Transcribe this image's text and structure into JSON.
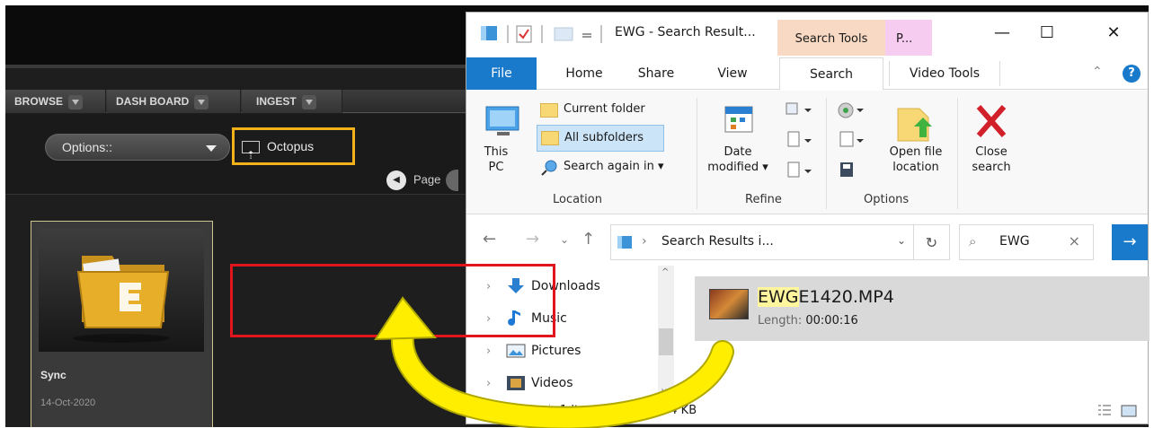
{
  "background_app": {
    "tabs": [
      {
        "label": "BROWSE"
      },
      {
        "label": "DASH BOARD"
      },
      {
        "label": "INGEST"
      }
    ],
    "options_select": {
      "value": "Options::"
    },
    "octopus_button": {
      "label": "Octopus"
    },
    "page_nav": {
      "label": "Page"
    },
    "card": {
      "name": "Sync",
      "date": "14-Oct-2020"
    }
  },
  "explorer": {
    "title": "EWG - Search Result...",
    "context_tabs": {
      "search_tools": "Search Tools",
      "p": "P..."
    },
    "window_controls": {
      "minimize": "—",
      "maximize": "☐",
      "close": "✕"
    },
    "ribbon_tabs": [
      "File",
      "Home",
      "Share",
      "View",
      "Search",
      "Video Tools"
    ],
    "ribbon": {
      "this_pc": [
        "This",
        "PC"
      ],
      "current_folder": "Current folder",
      "all_subfolders": "All subfolders",
      "search_again": "Search again in ▾",
      "location_label": "Location",
      "date_modified": [
        "Date",
        "modified ▾"
      ],
      "refine_label": "Refine",
      "open_file_location": [
        "Open file",
        "location"
      ],
      "options_label": "Options",
      "close_search": [
        "Close",
        "search"
      ]
    },
    "address": {
      "path": "Search Results i...",
      "search_query": "EWG"
    },
    "nav_items": [
      {
        "label": "Downloads"
      },
      {
        "label": "Music"
      },
      {
        "label": "Pictures"
      },
      {
        "label": "Videos"
      }
    ],
    "result": {
      "name_highlight": "EWG",
      "name_rest": "E1420.MP4",
      "length_label": "Length:",
      "length_value": "00:00:16"
    },
    "status": {
      "count": "1 item",
      "selected": "1 item selecte",
      "size": "54 KB"
    }
  },
  "colors": {
    "accent_blue": "#1979ca",
    "highlight_yellow": "#f3b21a",
    "result_border_red": "#e2141d",
    "arrow_yellow": "#ffee00"
  }
}
